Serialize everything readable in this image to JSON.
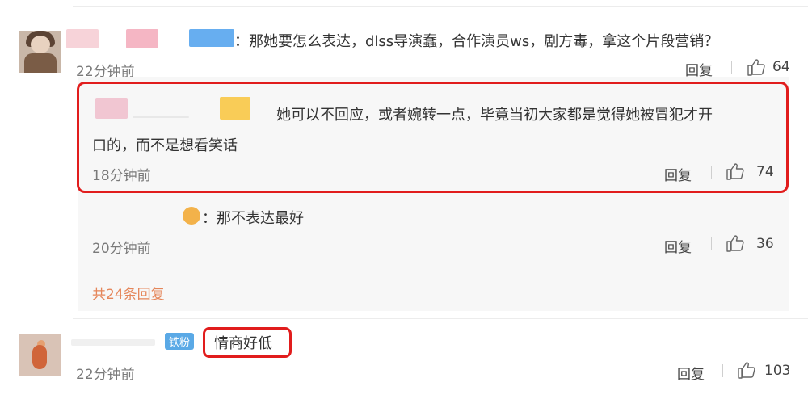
{
  "comments": [
    {
      "text": "：那她要怎么表达，dlss导演蠢，合作演员ws，剧方毒，拿这个片段营销？",
      "time": "22分钟前",
      "reply_label": "回复",
      "likes": "64"
    },
    {
      "text": "情商好低",
      "badge": "铁粉",
      "time": "22分钟前",
      "reply_label": "回复",
      "likes": "103"
    }
  ],
  "replies": [
    {
      "text_line1": "她可以不回应，或者婉转一点，毕竟当初大家都是觉得她被冒犯才开",
      "text_line2": "口的，而不是想看笑话",
      "time": "18分钟前",
      "reply_label": "回复",
      "likes": "74"
    },
    {
      "text": "：那不表达最好",
      "time": "20分钟前",
      "reply_label": "回复",
      "likes": "36"
    }
  ],
  "more_replies": "共24条回复",
  "colors": {
    "highlight": "#e11d1d",
    "link": "#e5865a",
    "badge": "#5aa9e6"
  }
}
